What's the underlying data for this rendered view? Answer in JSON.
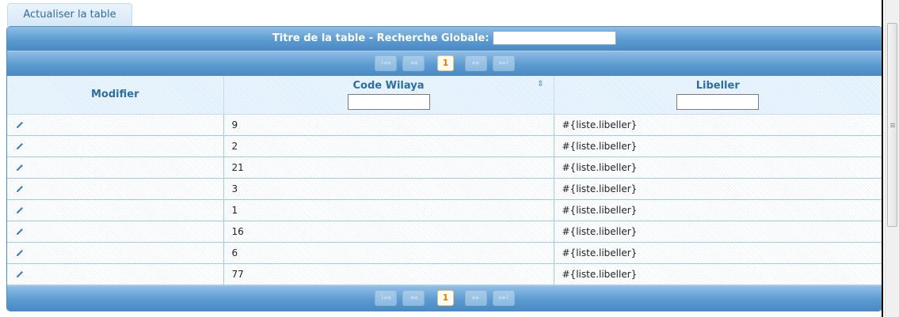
{
  "toolbar": {
    "refresh_label": "Actualiser la table"
  },
  "table": {
    "title": "Titre de la table - Recherche Globale:",
    "global_search_value": "",
    "columns": [
      {
        "label": "Modifier",
        "sortable": false,
        "filter": false
      },
      {
        "label": "Code Wilaya",
        "sortable": true,
        "filter": true,
        "filter_value": ""
      },
      {
        "label": "Libeller",
        "sortable": false,
        "filter": true,
        "filter_value": ""
      }
    ],
    "rows": [
      {
        "code": "9",
        "libeller": "#{liste.libeller}"
      },
      {
        "code": "2",
        "libeller": "#{liste.libeller}"
      },
      {
        "code": "21",
        "libeller": "#{liste.libeller}"
      },
      {
        "code": "3",
        "libeller": "#{liste.libeller}"
      },
      {
        "code": "1",
        "libeller": "#{liste.libeller}"
      },
      {
        "code": "16",
        "libeller": "#{liste.libeller}"
      },
      {
        "code": "6",
        "libeller": "#{liste.libeller}"
      },
      {
        "code": "77",
        "libeller": "#{liste.libeller}"
      }
    ],
    "paginator": {
      "current_page": "1",
      "first_glyph": "I◂◂",
      "prev_glyph": "◂◂",
      "next_glyph": "▸▸",
      "last_glyph": "▸▸I"
    }
  },
  "icons": {
    "edit": "pencil-icon",
    "sort": "sort-icon"
  },
  "colors": {
    "header_blue": "#5c9bd0",
    "column_text": "#2e6e9e",
    "page_accent": "#e07b00"
  }
}
